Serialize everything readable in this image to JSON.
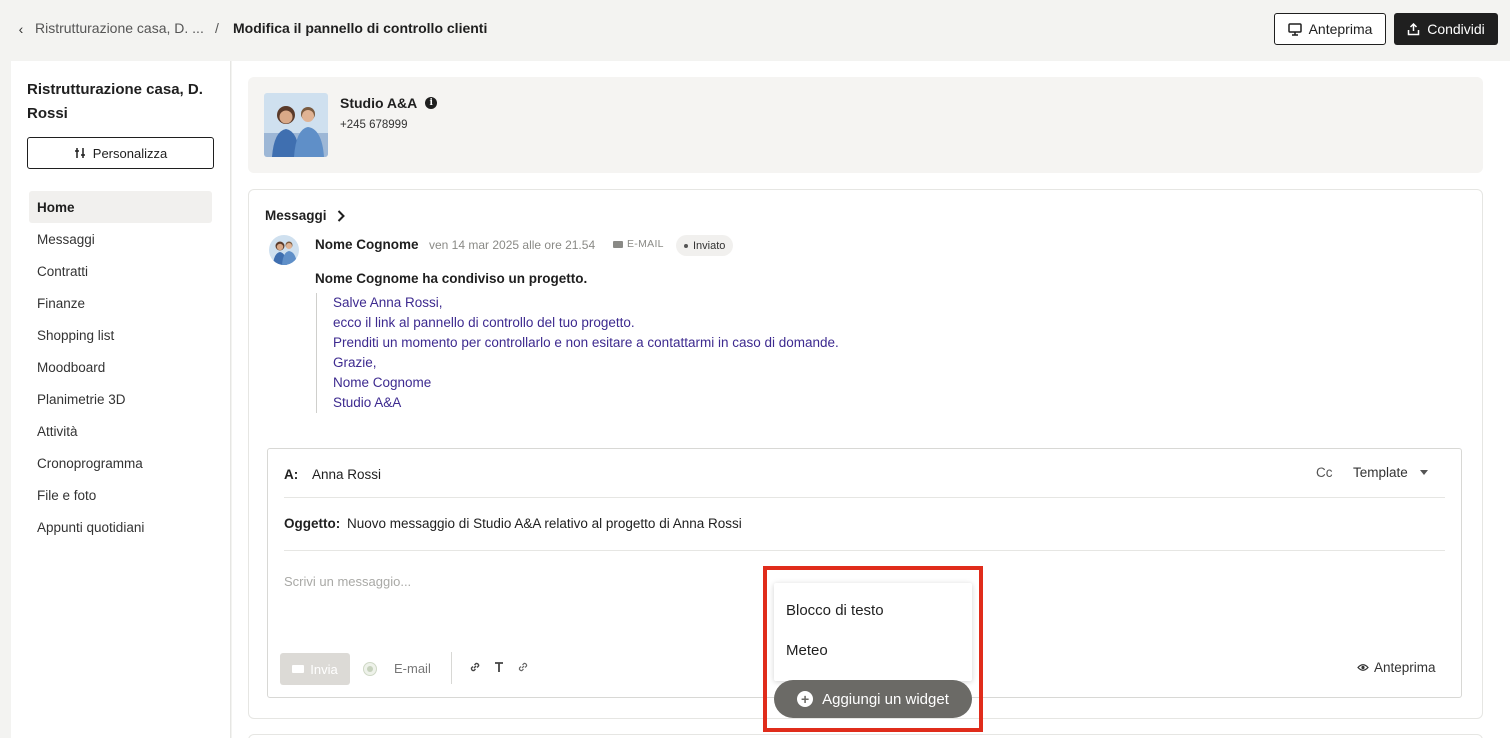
{
  "breadcrumb": {
    "back_glyph": "‹",
    "parent": "Ristrutturazione casa, D. ...",
    "separator": "/",
    "current": "Modifica il pannello di controllo clienti"
  },
  "header": {
    "preview_label": "Anteprima",
    "share_label": "Condividi"
  },
  "sidebar": {
    "project_title": "Ristrutturazione casa, D. Rossi",
    "customize_label": "Personalizza",
    "items": [
      {
        "label": "Home",
        "active": true
      },
      {
        "label": "Messaggi"
      },
      {
        "label": "Contratti"
      },
      {
        "label": "Finanze"
      },
      {
        "label": "Shopping list"
      },
      {
        "label": "Moodboard"
      },
      {
        "label": "Planimetrie 3D"
      },
      {
        "label": "Attività"
      },
      {
        "label": "Cronoprogramma"
      },
      {
        "label": "File e foto"
      },
      {
        "label": "Appunti quotidiani"
      }
    ]
  },
  "studio": {
    "name": "Studio A&A",
    "info_glyph": "i",
    "phone": "+245 678999"
  },
  "messages": {
    "section_title": "Messaggi",
    "message": {
      "sender": "Nome Cognome",
      "date": "ven 14 mar 2025 alle ore 21.54",
      "channel": "E-MAIL",
      "status": "Inviato",
      "shared_line": "Nome Cognome ha condiviso un progetto.",
      "lines": [
        "Salve Anna Rossi,",
        "ecco il link al pannello di controllo del tuo progetto.",
        "Prenditi un momento per controllarlo e non esitare a contattarmi in caso di domande.",
        "Grazie,",
        "Nome Cognome",
        "Studio A&A"
      ]
    }
  },
  "composer": {
    "to_label": "A:",
    "to_value": "Anna Rossi",
    "cc_label": "Cc",
    "template_label": "Template",
    "subject_label": "Oggetto:",
    "subject_value": "Nuovo messaggio di Studio A&A relativo al progetto di Anna Rossi",
    "body_placeholder": "Scrivi un messaggio...",
    "send_label": "Invia",
    "channel_label": "E-mail",
    "preview_label": "Anteprima"
  },
  "widget_menu": {
    "options": [
      "Blocco di testo",
      "Meteo"
    ],
    "add_label": "Aggiungi un widget",
    "plus_glyph": "+"
  },
  "colors": {
    "highlight": "#e02c1b",
    "message_text": "#3d2a8f",
    "primary_dark": "#1f1f1f"
  }
}
